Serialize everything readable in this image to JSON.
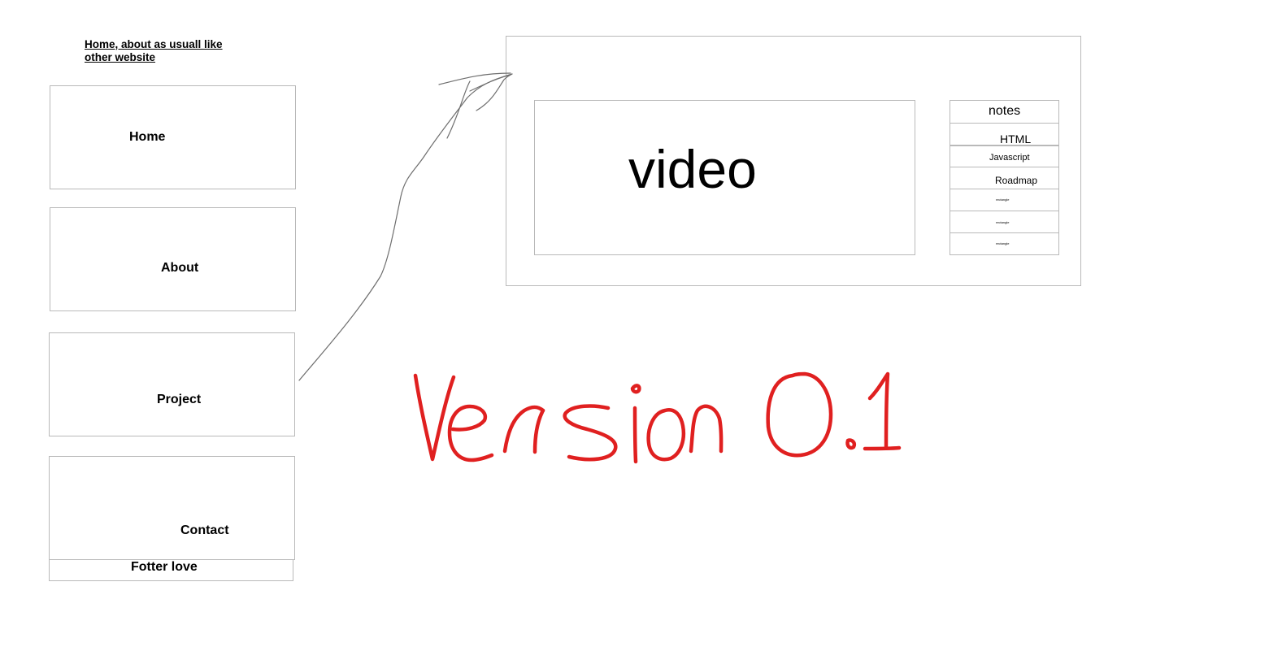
{
  "top_note": "Home, about as usuall like other website",
  "nav": {
    "home": "Home",
    "about": "About",
    "project": "Project",
    "contact": "Contact"
  },
  "footer": "Fotter love",
  "preview": {
    "video_label": "video",
    "notes": {
      "header": "notes",
      "items": [
        "HTML",
        "Javascript",
        "Roadmap",
        "rectangle",
        "rectangle",
        "rectangle"
      ]
    }
  },
  "annotation": {
    "text": "Version 0.1",
    "color": "#e02020"
  },
  "colors": {
    "box_border": "#b9b9b9",
    "sketch_line": "#6e6e6e"
  }
}
